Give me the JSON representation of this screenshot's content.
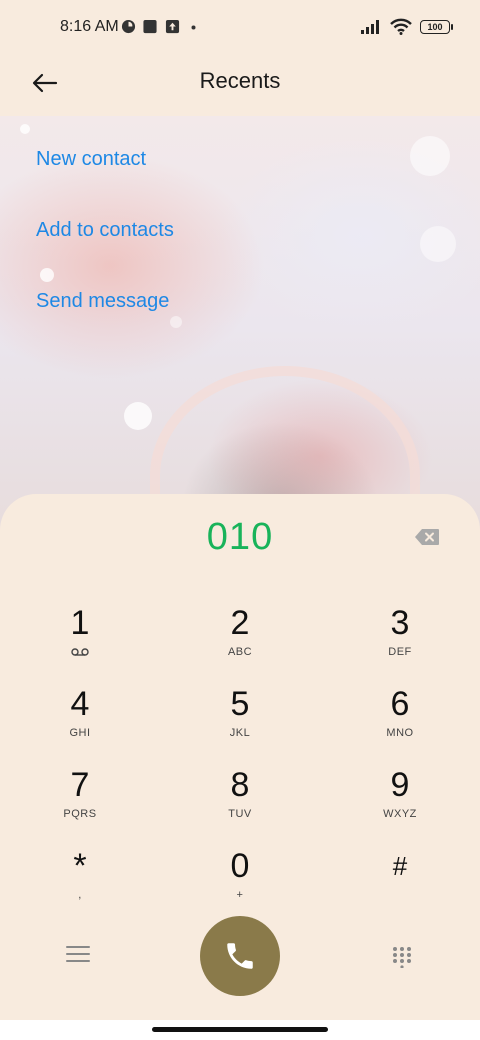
{
  "status_bar": {
    "time": "8:16 AM",
    "battery": "100",
    "icons": [
      "app-notification-icon",
      "square-notification-icon",
      "upload-notification-icon",
      "dot-icon",
      "signal-icon",
      "wifi-icon",
      "battery-icon"
    ]
  },
  "header": {
    "title": "Recents",
    "back_icon": "arrow-left-icon"
  },
  "actions": {
    "new_contact": "New contact",
    "add_to_contacts": "Add to contacts",
    "send_message": "Send message"
  },
  "dialer": {
    "number": "010",
    "number_color": "#19b35a",
    "backspace_icon": "backspace-icon",
    "keys": [
      {
        "digit": "1",
        "letters": ""
      },
      {
        "digit": "2",
        "letters": "ABC"
      },
      {
        "digit": "3",
        "letters": "DEF"
      },
      {
        "digit": "4",
        "letters": "GHI"
      },
      {
        "digit": "5",
        "letters": "JKL"
      },
      {
        "digit": "6",
        "letters": "MNO"
      },
      {
        "digit": "7",
        "letters": "PQRS"
      },
      {
        "digit": "8",
        "letters": "TUV"
      },
      {
        "digit": "9",
        "letters": "WXYZ"
      },
      {
        "digit": "*",
        "letters": ","
      },
      {
        "digit": "0",
        "letters": "+"
      },
      {
        "digit": "#",
        "letters": ""
      }
    ],
    "call_button_color": "#8a7a4a",
    "menu_icon": "menu-icon",
    "call_icon": "phone-icon",
    "keypad_icon": "dialpad-icon"
  },
  "colors": {
    "background": "#f8ebde",
    "link": "#1e88e5"
  }
}
